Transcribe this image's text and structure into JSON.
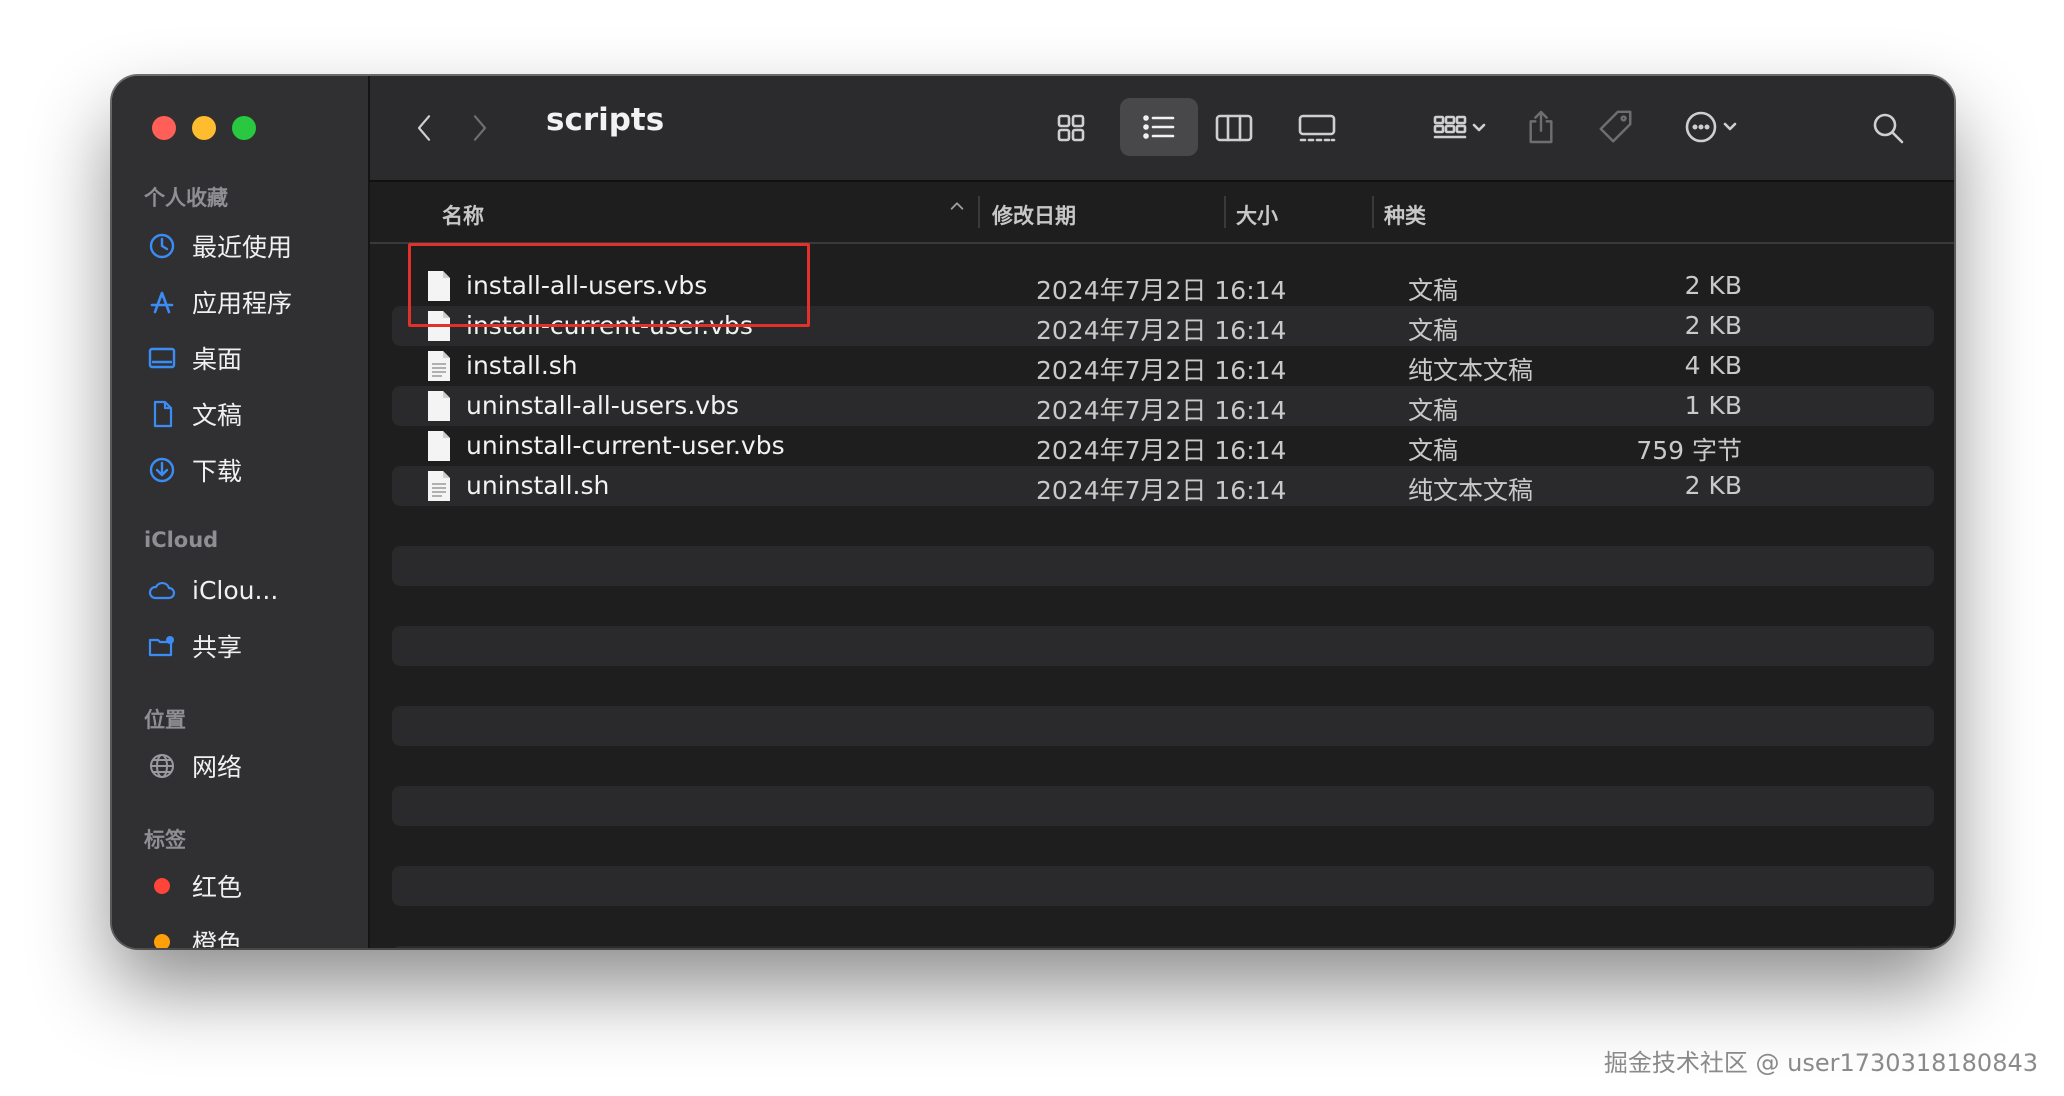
{
  "window": {
    "title": "scripts"
  },
  "sidebar": {
    "sections": [
      {
        "label": "个人收藏",
        "items": [
          {
            "label": "最近使用",
            "icon": "clock-icon"
          },
          {
            "label": "应用程序",
            "icon": "apps-icon"
          },
          {
            "label": "桌面",
            "icon": "desktop-icon"
          },
          {
            "label": "文稿",
            "icon": "document-icon"
          },
          {
            "label": "下载",
            "icon": "download-icon"
          }
        ]
      },
      {
        "label": "iCloud",
        "items": [
          {
            "label": "iClou...",
            "icon": "cloud-icon"
          },
          {
            "label": "共享",
            "icon": "shared-folder-icon"
          }
        ]
      },
      {
        "label": "位置",
        "items": [
          {
            "label": "网络",
            "icon": "globe-icon"
          }
        ]
      },
      {
        "label": "标签",
        "items": [
          {
            "label": "红色",
            "color": "#ff453a"
          },
          {
            "label": "橙色",
            "color": "#ff9f0a"
          }
        ]
      }
    ]
  },
  "columns": {
    "name": "名称",
    "date": "修改日期",
    "size": "大小",
    "kind": "种类"
  },
  "files": [
    {
      "name": "install-all-users.vbs",
      "date": "2024年7月2日 16:14",
      "size": "2 KB",
      "kind": "文稿"
    },
    {
      "name": "install-current-user.vbs",
      "date": "2024年7月2日 16:14",
      "size": "2 KB",
      "kind": "文稿"
    },
    {
      "name": "install.sh",
      "date": "2024年7月2日 16:14",
      "size": "4 KB",
      "kind": "纯文本文稿"
    },
    {
      "name": "uninstall-all-users.vbs",
      "date": "2024年7月2日 16:14",
      "size": "1 KB",
      "kind": "文稿"
    },
    {
      "name": "uninstall-current-user.vbs",
      "date": "2024年7月2日 16:14",
      "size": "759 字节",
      "kind": "文稿"
    },
    {
      "name": "uninstall.sh",
      "date": "2024年7月2日 16:14",
      "size": "2 KB",
      "kind": "纯文本文稿"
    }
  ],
  "annotation": {
    "color": "#e0322b"
  },
  "watermark": "掘金技术社区 @ user1730318180843"
}
